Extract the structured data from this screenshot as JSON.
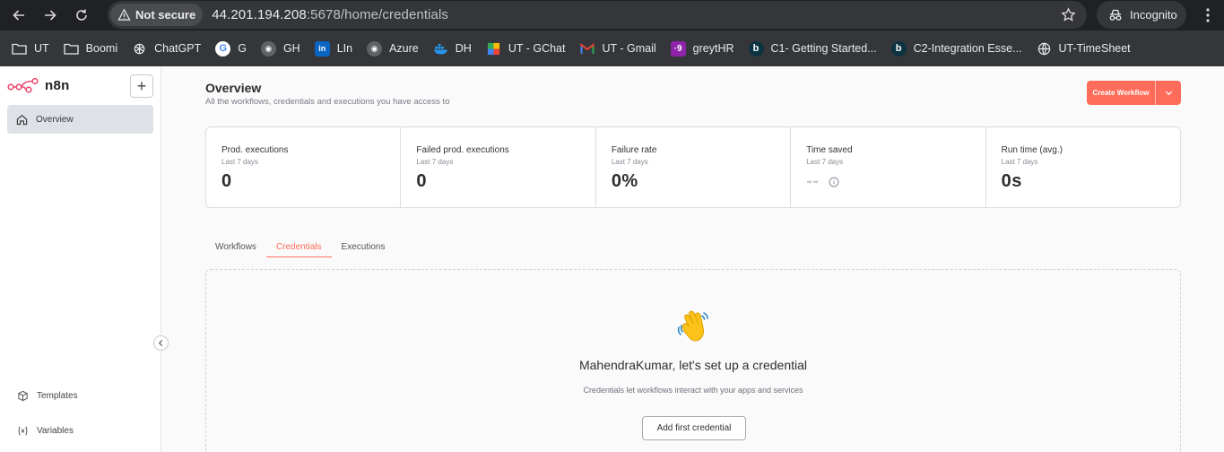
{
  "browser": {
    "security_label": "Not secure",
    "url_host": "44.201.194.208",
    "url_path": ":5678/home/credentials",
    "profile_label": "Incognito"
  },
  "bookmarks": [
    {
      "label": "UT",
      "icon": "folder-icon"
    },
    {
      "label": "Boomi",
      "icon": "folder-icon"
    },
    {
      "label": "ChatGPT",
      "icon": "chatgpt-icon"
    },
    {
      "label": "G",
      "icon": "google-icon"
    },
    {
      "label": "GH",
      "icon": "github-icon"
    },
    {
      "label": "LIn",
      "icon": "linkedin-icon"
    },
    {
      "label": "Azure",
      "icon": "github-icon"
    },
    {
      "label": "DH",
      "icon": "docker-icon"
    },
    {
      "label": "UT - GChat",
      "icon": "gchat-icon"
    },
    {
      "label": "UT - Gmail",
      "icon": "gmail-icon"
    },
    {
      "label": "greytHR",
      "icon": "greythr-icon"
    },
    {
      "label": "C1- Getting Started...",
      "icon": "boomi-b-icon"
    },
    {
      "label": "C2-Integration Esse...",
      "icon": "boomi-b-icon"
    },
    {
      "label": "UT-TimeSheet",
      "icon": "globe-icon"
    }
  ],
  "sidebar": {
    "logo_text": "n8n",
    "overview_label": "Overview",
    "templates_label": "Templates",
    "variables_label": "Variables"
  },
  "main": {
    "title": "Overview",
    "subtitle": "All the workflows, credentials and executions you have access to",
    "create_label": "Create Workflow"
  },
  "stats": [
    {
      "label": "Prod. executions",
      "sub": "Last 7 days",
      "value": "0"
    },
    {
      "label": "Failed prod. executions",
      "sub": "Last 7 days",
      "value": "0"
    },
    {
      "label": "Failure rate",
      "sub": "Last 7 days",
      "value": "0%"
    },
    {
      "label": "Time saved",
      "sub": "Last 7 days",
      "value": "--"
    },
    {
      "label": "Run time (avg.)",
      "sub": "Last 7 days",
      "value": "0s"
    }
  ],
  "tabs": [
    {
      "label": "Workflows",
      "active": false
    },
    {
      "label": "Credentials",
      "active": true
    },
    {
      "label": "Executions",
      "active": false
    }
  ],
  "empty_state": {
    "heading": "MahendraKumar, let's set up a credential",
    "description": "Credentials let workflows interact with your apps and services",
    "button_label": "Add first credential"
  },
  "colors": {
    "accent": "#ff6d5a",
    "browser_bg": "#202124",
    "bookmark_bar": "#35363a"
  }
}
